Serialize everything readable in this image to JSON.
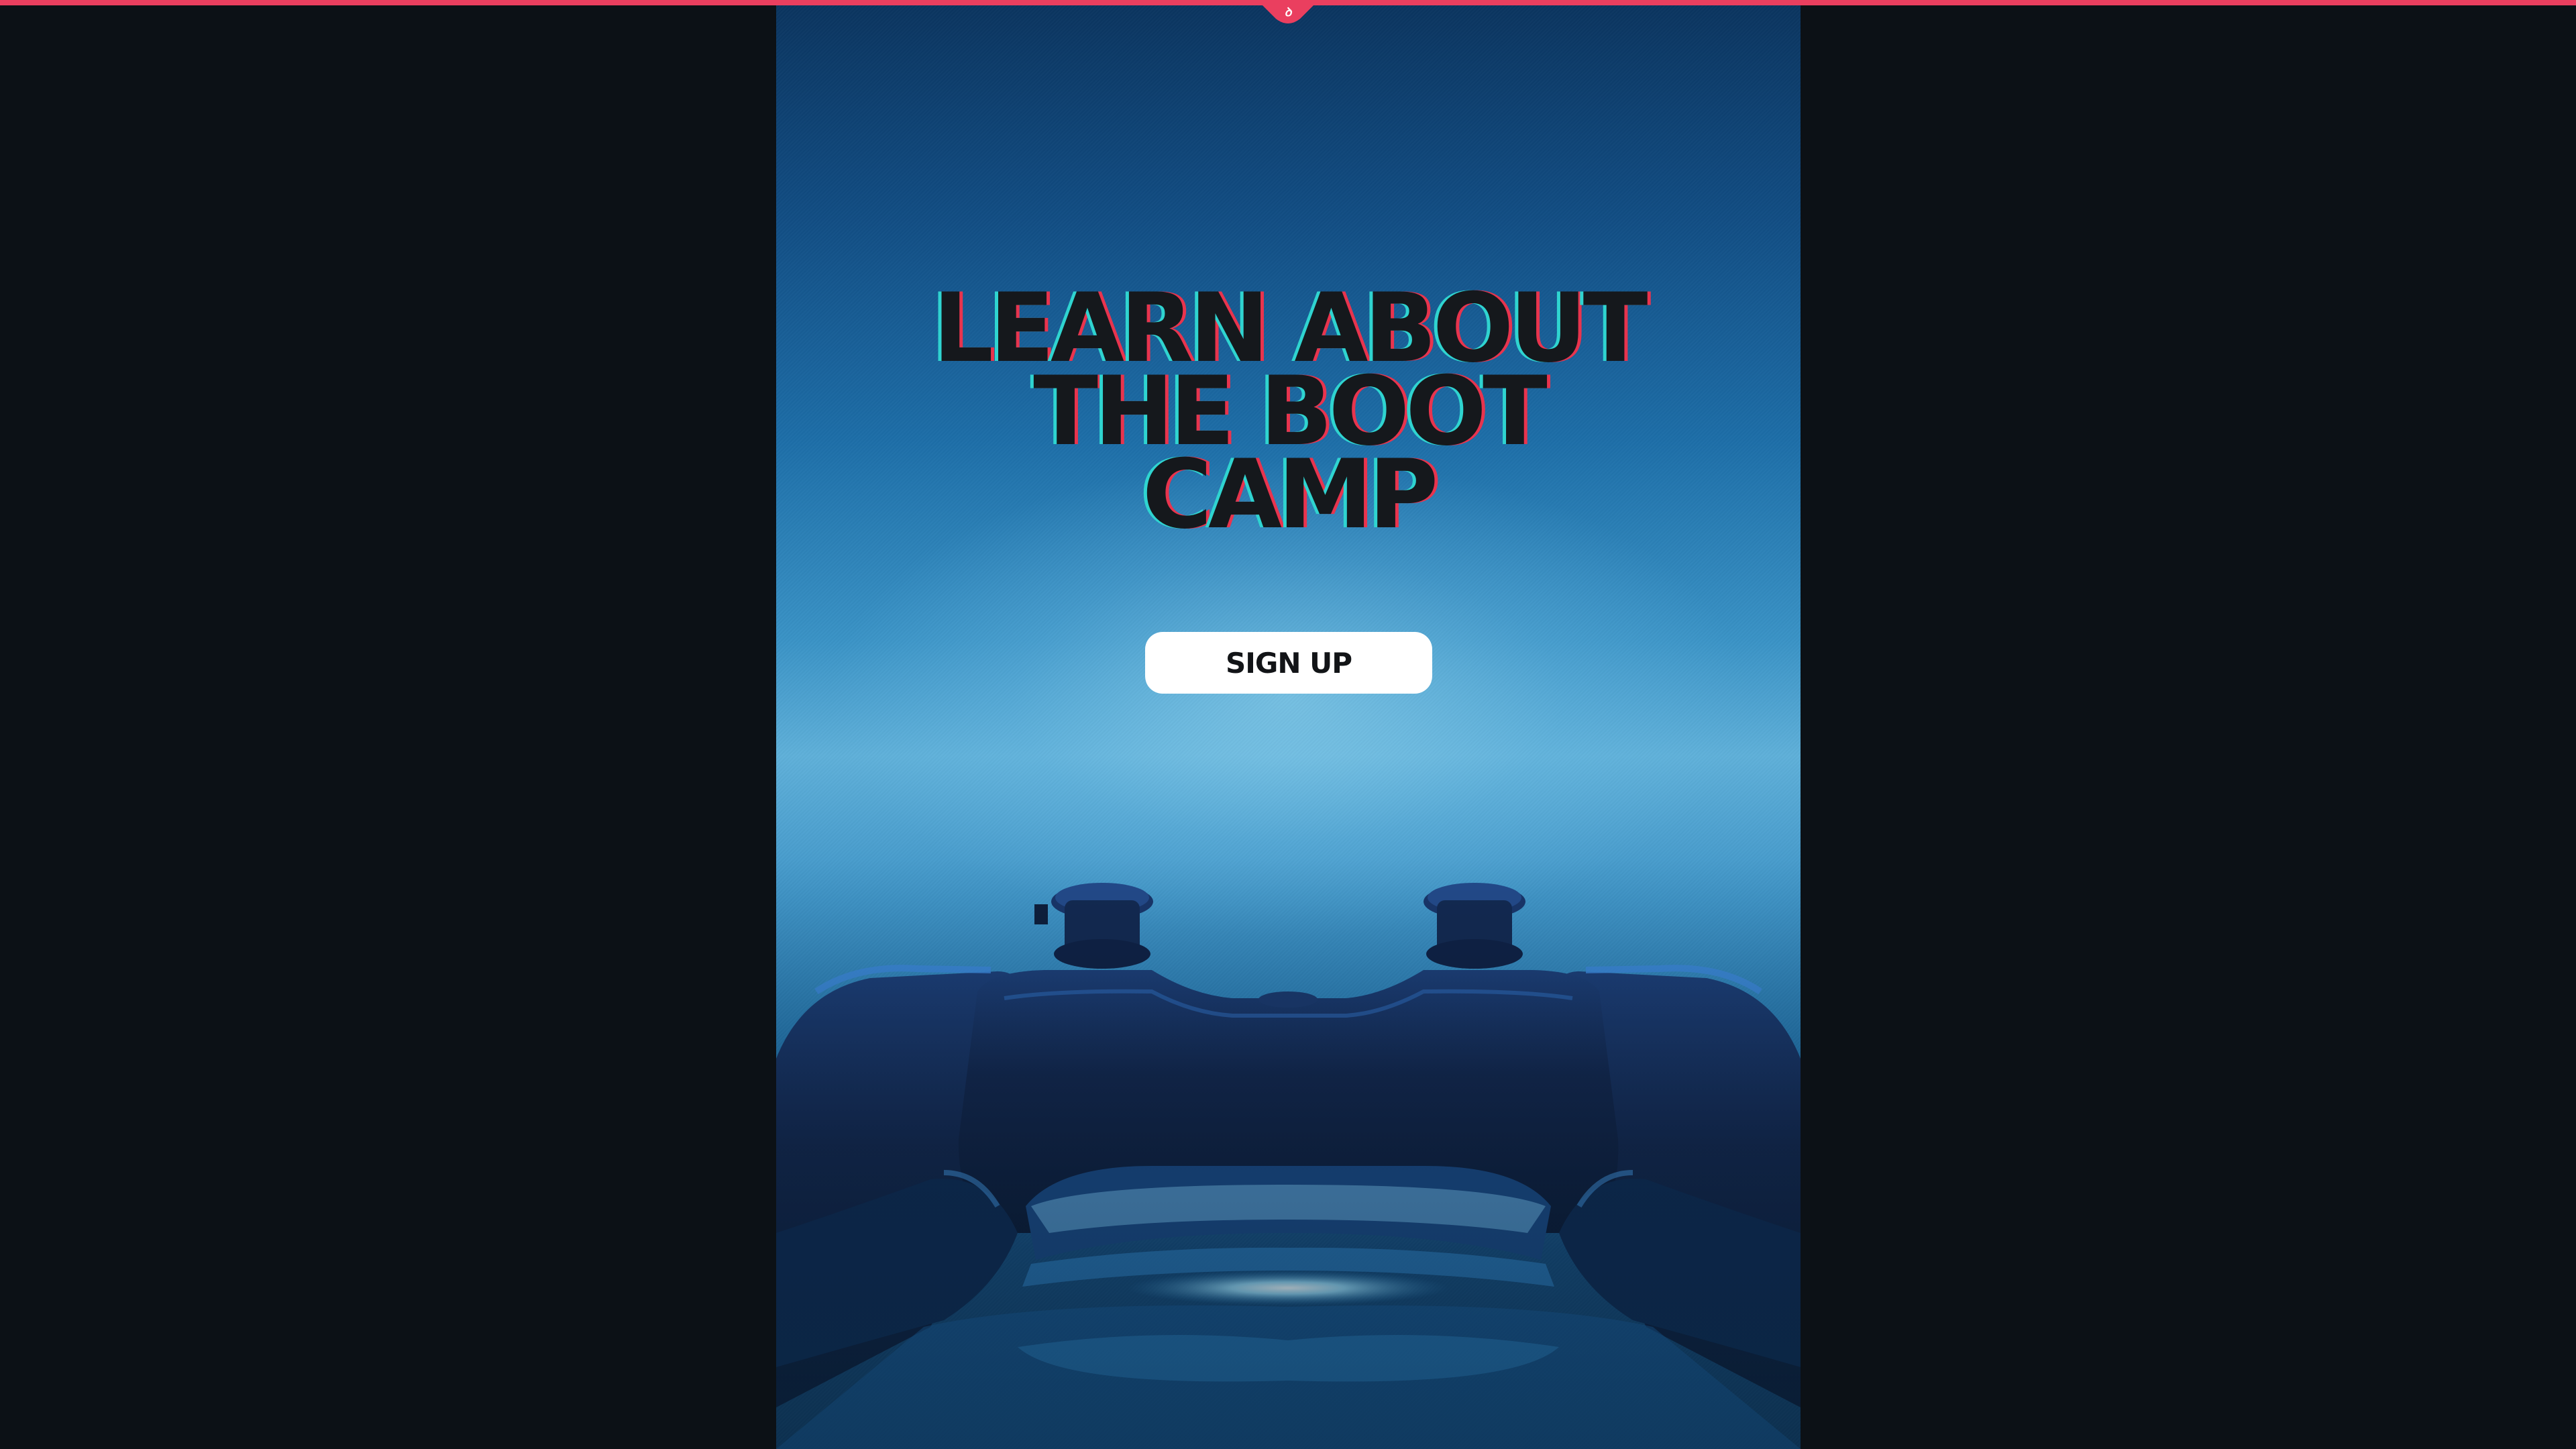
{
  "header": {
    "accent_color": "#ea3f5f",
    "tab_icon": "logo-icon"
  },
  "hero": {
    "heading_lines": [
      "LEARN ABOUT",
      "THE BOOT",
      "CAMP"
    ],
    "signup_label": "SIGN UP",
    "background_image": "game-controller-photo"
  },
  "colors": {
    "page_background": "#0c1116",
    "heading_text": "#15181c",
    "heading_shadow_cyan": "#2fd4d0",
    "heading_shadow_red": "#e8344e",
    "button_background": "#ffffff"
  }
}
